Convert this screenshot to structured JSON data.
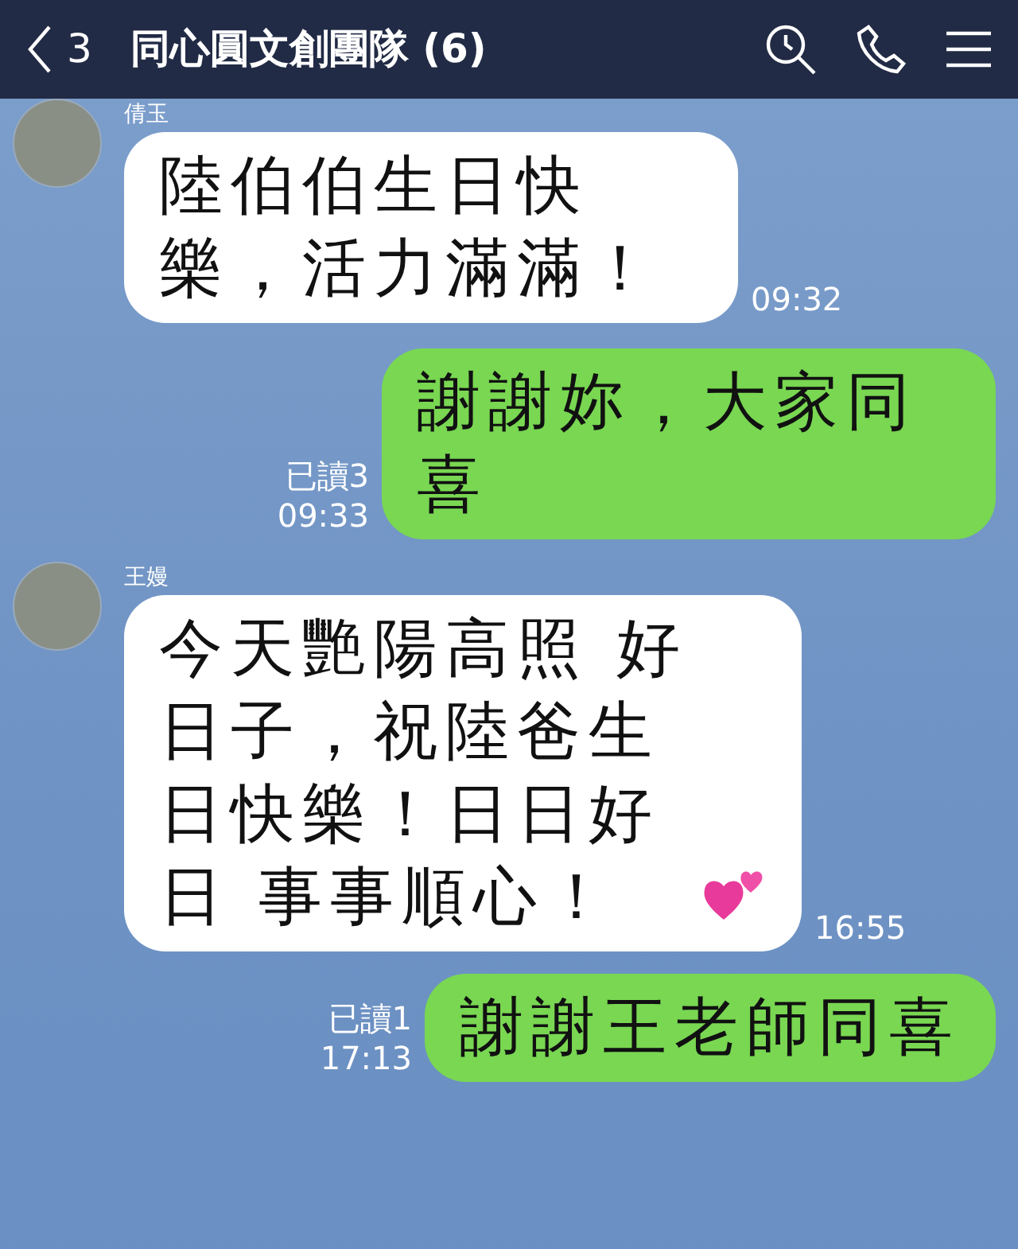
{
  "header": {
    "back_count": "3",
    "title": "同心圓文創團隊 (6)"
  },
  "messages": [
    {
      "kind": "incoming",
      "sender": "倩玉",
      "text": "陸伯伯生日快樂，活力滿滿！",
      "time": "09:32"
    },
    {
      "kind": "outgoing",
      "read": "已讀3",
      "text": "謝謝妳，大家同喜",
      "time": "09:33"
    },
    {
      "kind": "incoming",
      "sender": "王嫚",
      "text": "今天艷陽高照 好日子，祝陸爸生日快樂！日日好日 事事順心！",
      "time": "16:55",
      "hearts": true
    },
    {
      "kind": "outgoing",
      "read": "已讀1",
      "text": "謝謝王老師同喜",
      "time": "17:13"
    }
  ]
}
